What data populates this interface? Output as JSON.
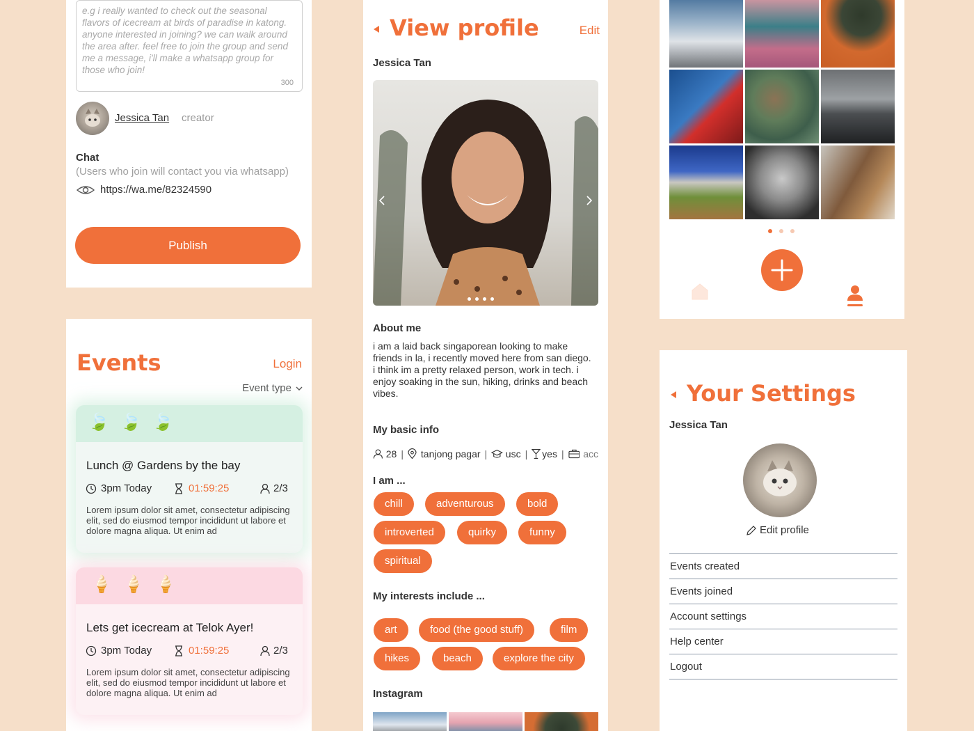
{
  "create": {
    "placeholder": "e.g i really wanted to check out the seasonal flavors of icecream at birds of paradise in katong. anyone interested in joining? we can walk around the area after. feel free to join the group and send me a message, i'll make a whatsapp group for those who join!",
    "char_count": "300",
    "creator_name": "Jessica Tan",
    "creator_role": "creator",
    "chat_label": "Chat",
    "chat_note": "(Users who join will contact you via whatsapp)",
    "chat_link": "https://wa.me/82324590",
    "publish_label": "Publish"
  },
  "events": {
    "title": "Events",
    "login_label": "Login",
    "filter_label": "Event type",
    "cards": [
      {
        "emoji": "🍃",
        "title": "Lunch @ Gardens by the bay",
        "time": "3pm Today",
        "countdown": "01:59:25",
        "capacity": "2/3",
        "desc": "Lorem ipsum dolor sit amet, consectetur adipiscing elit, sed do eiusmod tempor incididunt ut labore et dolore magna aliqua. Ut enim ad",
        "tint": "#d5f0e2"
      },
      {
        "emoji": "🍦",
        "title": "Lets get icecream at Telok Ayer!",
        "time": "3pm Today",
        "countdown": "01:59:25",
        "capacity": "2/3",
        "desc": "Lorem ipsum dolor sit amet, consectetur adipiscing elit, sed do eiusmod tempor incididunt ut labore et dolore magna aliqua. Ut enim ad",
        "tint": "#fcd9e2"
      }
    ]
  },
  "profile": {
    "title": "View profile",
    "edit_label": "Edit",
    "name": "Jessica Tan",
    "about_heading": "About me",
    "about_text": "i am a laid back singaporean looking to make friends in la, i recently moved here from san diego. i think im a pretty relaxed person, work in tech. i enjoy soaking in the sun, hiking, drinks and beach vibes.",
    "basic_heading": "My basic info",
    "basic": {
      "age": "28",
      "location": "tanjong pagar",
      "school": "usc",
      "drinks": "yes",
      "job": "acc"
    },
    "iam_heading": "I am ...",
    "traits": [
      "chill",
      "adventurous",
      "bold",
      "introverted",
      "quirky",
      "funny",
      "spiritual"
    ],
    "interests_heading": "My interests include ...",
    "interests": [
      "art",
      "food (the good stuff)",
      "film",
      "hikes",
      "beach",
      "explore the city"
    ],
    "instagram_heading": "Instagram"
  },
  "gallery": {
    "tiles": [
      "stupa-cloud",
      "pink-clouds",
      "coffee-leaf",
      "red-lighthouse",
      "green-aerial",
      "black-beach",
      "blue-mountains",
      "bw-portrait",
      "hair-blur"
    ]
  },
  "settings": {
    "title": "Your Settings",
    "name": "Jessica Tan",
    "edit_profile_label": "Edit profile",
    "menu": [
      "Events created",
      "Events joined",
      "Account settings",
      "Help center",
      "Logout"
    ]
  },
  "colors": {
    "accent": "#f0703a",
    "background": "#f6dfc9"
  }
}
